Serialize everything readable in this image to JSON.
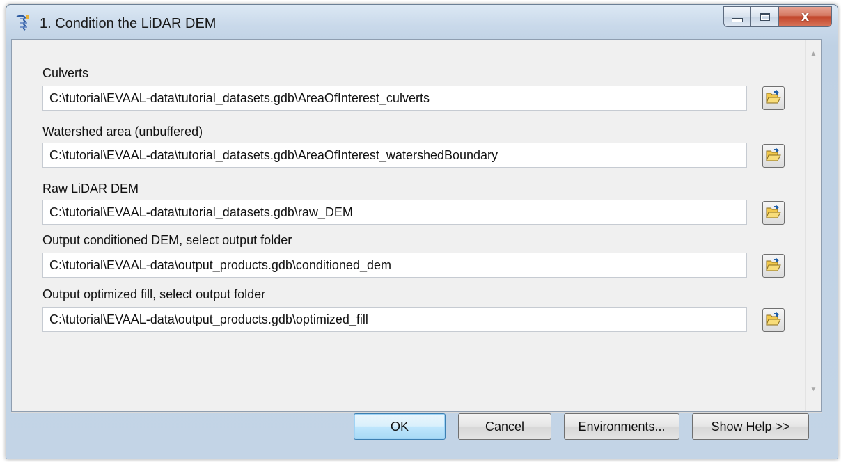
{
  "window": {
    "title": "1. Condition the LiDAR DEM",
    "close_glyph": "x"
  },
  "fields": [
    {
      "label": "Culverts",
      "value": "C:\\tutorial\\EVAAL-data\\tutorial_datasets.gdb\\AreaOfInterest_culverts"
    },
    {
      "label": "Watershed area (unbuffered)",
      "value": "C:\\tutorial\\EVAAL-data\\tutorial_datasets.gdb\\AreaOfInterest_watershedBoundary"
    },
    {
      "label": "Raw LiDAR DEM",
      "value": "C:\\tutorial\\EVAAL-data\\tutorial_datasets.gdb\\raw_DEM"
    },
    {
      "label": "Output conditioned DEM, select output folder",
      "value": "C:\\tutorial\\EVAAL-data\\output_products.gdb\\conditioned_dem"
    },
    {
      "label": "Output optimized fill, select output folder",
      "value": "C:\\tutorial\\EVAAL-data\\output_products.gdb\\optimized_fill"
    }
  ],
  "buttons": {
    "ok": "OK",
    "cancel": "Cancel",
    "environments": "Environments...",
    "show_help": "Show Help >>"
  },
  "icons": {
    "app": "toolbox-script-icon",
    "browse": "folder-open-icon"
  },
  "colors": {
    "ok_border": "#3c7fb1",
    "close_button": "#c2452a",
    "folder_yellow": "#f2c94c"
  }
}
